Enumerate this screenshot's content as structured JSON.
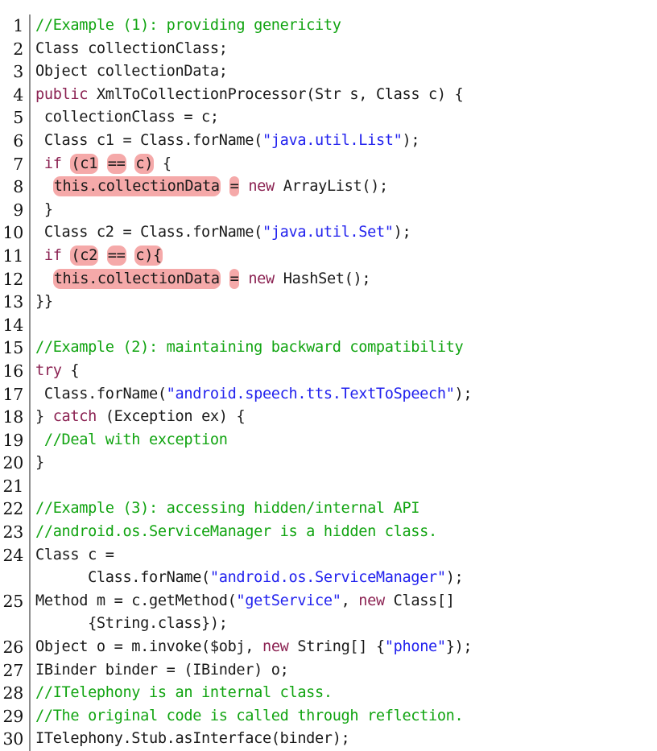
{
  "listing": {
    "language": "Java",
    "font_size_px": 18.6,
    "colors": {
      "comment": "#11a411",
      "string": "#2222ee",
      "keyword": "#8b2252",
      "plain": "#1a1a1a",
      "highlight": "#f5a9a9",
      "gutter_rule": "#8c8c8c",
      "background": "#ffffff"
    },
    "lines": [
      {
        "number": "1",
        "tokens": [
          {
            "text": "//Example (1): providing genericity",
            "style": "cmt",
            "hl": false
          }
        ]
      },
      {
        "number": "2",
        "tokens": [
          {
            "text": "Class collectionClass;",
            "style": "pln",
            "hl": false
          }
        ]
      },
      {
        "number": "3",
        "tokens": [
          {
            "text": "Object collectionData;",
            "style": "pln",
            "hl": false
          }
        ]
      },
      {
        "number": "4",
        "tokens": [
          {
            "text": "public",
            "style": "kw",
            "hl": false
          },
          {
            "text": " XmlToCollectionProcessor(Str s, Class c) {",
            "style": "pln",
            "hl": false
          }
        ]
      },
      {
        "number": "5",
        "tokens": [
          {
            "text": " collectionClass = c;",
            "style": "pln",
            "hl": false
          }
        ]
      },
      {
        "number": "6",
        "tokens": [
          {
            "text": " Class c1 = Class.forName(",
            "style": "pln",
            "hl": false
          },
          {
            "text": "\"java.util.List\"",
            "style": "str",
            "hl": false
          },
          {
            "text": ");",
            "style": "pln",
            "hl": false
          }
        ]
      },
      {
        "number": "7",
        "tokens": [
          {
            "text": " if ",
            "style": "kw",
            "hl": false
          },
          {
            "text": "(c1",
            "style": "pln",
            "hl": true
          },
          {
            "text": " ",
            "style": "pln",
            "hl": false
          },
          {
            "text": "==",
            "style": "pln",
            "hl": true
          },
          {
            "text": " ",
            "style": "pln",
            "hl": false
          },
          {
            "text": "c)",
            "style": "pln",
            "hl": true
          },
          {
            "text": " {",
            "style": "pln",
            "hl": false
          }
        ]
      },
      {
        "number": "8",
        "tokens": [
          {
            "text": "  ",
            "style": "pln",
            "hl": false
          },
          {
            "text": "this.collectionData",
            "style": "pln",
            "hl": true
          },
          {
            "text": " ",
            "style": "pln",
            "hl": false
          },
          {
            "text": "=",
            "style": "pln",
            "hl": true
          },
          {
            "text": " ",
            "style": "pln",
            "hl": false
          },
          {
            "text": "new",
            "style": "kw",
            "hl": false
          },
          {
            "text": " ArrayList();",
            "style": "pln",
            "hl": false
          }
        ]
      },
      {
        "number": "9",
        "tokens": [
          {
            "text": " }",
            "style": "pln",
            "hl": false
          }
        ]
      },
      {
        "number": "10",
        "tokens": [
          {
            "text": " Class c2 = Class.forName(",
            "style": "pln",
            "hl": false
          },
          {
            "text": "\"java.util.Set\"",
            "style": "str",
            "hl": false
          },
          {
            "text": ");",
            "style": "pln",
            "hl": false
          }
        ]
      },
      {
        "number": "11",
        "tokens": [
          {
            "text": " if ",
            "style": "kw",
            "hl": false
          },
          {
            "text": "(c2",
            "style": "pln",
            "hl": true
          },
          {
            "text": " ",
            "style": "pln",
            "hl": false
          },
          {
            "text": "==",
            "style": "pln",
            "hl": true
          },
          {
            "text": " ",
            "style": "pln",
            "hl": false
          },
          {
            "text": "c){",
            "style": "pln",
            "hl": true
          }
        ]
      },
      {
        "number": "12",
        "tokens": [
          {
            "text": "  ",
            "style": "pln",
            "hl": false
          },
          {
            "text": "this.collectionData",
            "style": "pln",
            "hl": true
          },
          {
            "text": " ",
            "style": "pln",
            "hl": false
          },
          {
            "text": "=",
            "style": "pln",
            "hl": true
          },
          {
            "text": " ",
            "style": "pln",
            "hl": false
          },
          {
            "text": "new",
            "style": "kw",
            "hl": false
          },
          {
            "text": " HashSet();",
            "style": "pln",
            "hl": false
          }
        ]
      },
      {
        "number": "13",
        "tokens": [
          {
            "text": "}}",
            "style": "pln",
            "hl": false
          }
        ]
      },
      {
        "number": "14",
        "tokens": [
          {
            "text": "",
            "style": "pln",
            "hl": false
          }
        ]
      },
      {
        "number": "15",
        "tokens": [
          {
            "text": "//Example (2): maintaining backward compatibility",
            "style": "cmt",
            "hl": false
          }
        ]
      },
      {
        "number": "16",
        "tokens": [
          {
            "text": "try",
            "style": "kw",
            "hl": false
          },
          {
            "text": " {",
            "style": "pln",
            "hl": false
          }
        ]
      },
      {
        "number": "17",
        "tokens": [
          {
            "text": " Class.forName(",
            "style": "pln",
            "hl": false
          },
          {
            "text": "\"android.speech.tts.TextToSpeech\"",
            "style": "str",
            "hl": false
          },
          {
            "text": ");",
            "style": "pln",
            "hl": false
          }
        ]
      },
      {
        "number": "18",
        "tokens": [
          {
            "text": "} ",
            "style": "pln",
            "hl": false
          },
          {
            "text": "catch",
            "style": "kw",
            "hl": false
          },
          {
            "text": " (Exception ex) {",
            "style": "pln",
            "hl": false
          }
        ]
      },
      {
        "number": "19",
        "tokens": [
          {
            "text": " //Deal with exception",
            "style": "cmt",
            "hl": false
          }
        ]
      },
      {
        "number": "20",
        "tokens": [
          {
            "text": "}",
            "style": "pln",
            "hl": false
          }
        ]
      },
      {
        "number": "21",
        "tokens": [
          {
            "text": "",
            "style": "pln",
            "hl": false
          }
        ]
      },
      {
        "number": "22",
        "tokens": [
          {
            "text": "//Example (3): accessing hidden/internal API",
            "style": "cmt",
            "hl": false
          }
        ]
      },
      {
        "number": "23",
        "tokens": [
          {
            "text": "//android.os.ServiceManager is a hidden class.",
            "style": "cmt",
            "hl": false
          }
        ]
      },
      {
        "number": "24",
        "tokens": [
          {
            "text": "Class c =",
            "style": "pln",
            "hl": false
          }
        ],
        "continuation": [
          {
            "text": "      Class.forName(",
            "style": "pln",
            "hl": false
          },
          {
            "text": "\"android.os.ServiceManager\"",
            "style": "str",
            "hl": false
          },
          {
            "text": ");",
            "style": "pln",
            "hl": false
          }
        ]
      },
      {
        "number": "25",
        "tokens": [
          {
            "text": "Method m = c.getMethod(",
            "style": "pln",
            "hl": false
          },
          {
            "text": "\"getService\"",
            "style": "str",
            "hl": false
          },
          {
            "text": ", ",
            "style": "pln",
            "hl": false
          },
          {
            "text": "new",
            "style": "kw",
            "hl": false
          },
          {
            "text": " Class[]",
            "style": "pln",
            "hl": false
          }
        ],
        "continuation": [
          {
            "text": "      {String.class});",
            "style": "pln",
            "hl": false
          }
        ]
      },
      {
        "number": "26",
        "tokens": [
          {
            "text": "Object o = m.invoke($obj, ",
            "style": "pln",
            "hl": false
          },
          {
            "text": "new",
            "style": "kw",
            "hl": false
          },
          {
            "text": " String[] {",
            "style": "pln",
            "hl": false
          },
          {
            "text": "\"phone\"",
            "style": "str",
            "hl": false
          },
          {
            "text": "});",
            "style": "pln",
            "hl": false
          }
        ]
      },
      {
        "number": "27",
        "tokens": [
          {
            "text": "IBinder binder = (IBinder) o;",
            "style": "pln",
            "hl": false
          }
        ]
      },
      {
        "number": "28",
        "tokens": [
          {
            "text": "//ITelephony is an internal class.",
            "style": "cmt",
            "hl": false
          }
        ]
      },
      {
        "number": "29",
        "tokens": [
          {
            "text": "//The original code is called through reflection.",
            "style": "cmt",
            "hl": false
          }
        ]
      },
      {
        "number": "30",
        "tokens": [
          {
            "text": "ITelephony.Stub.asInterface(binder);",
            "style": "pln",
            "hl": false
          }
        ]
      }
    ]
  }
}
